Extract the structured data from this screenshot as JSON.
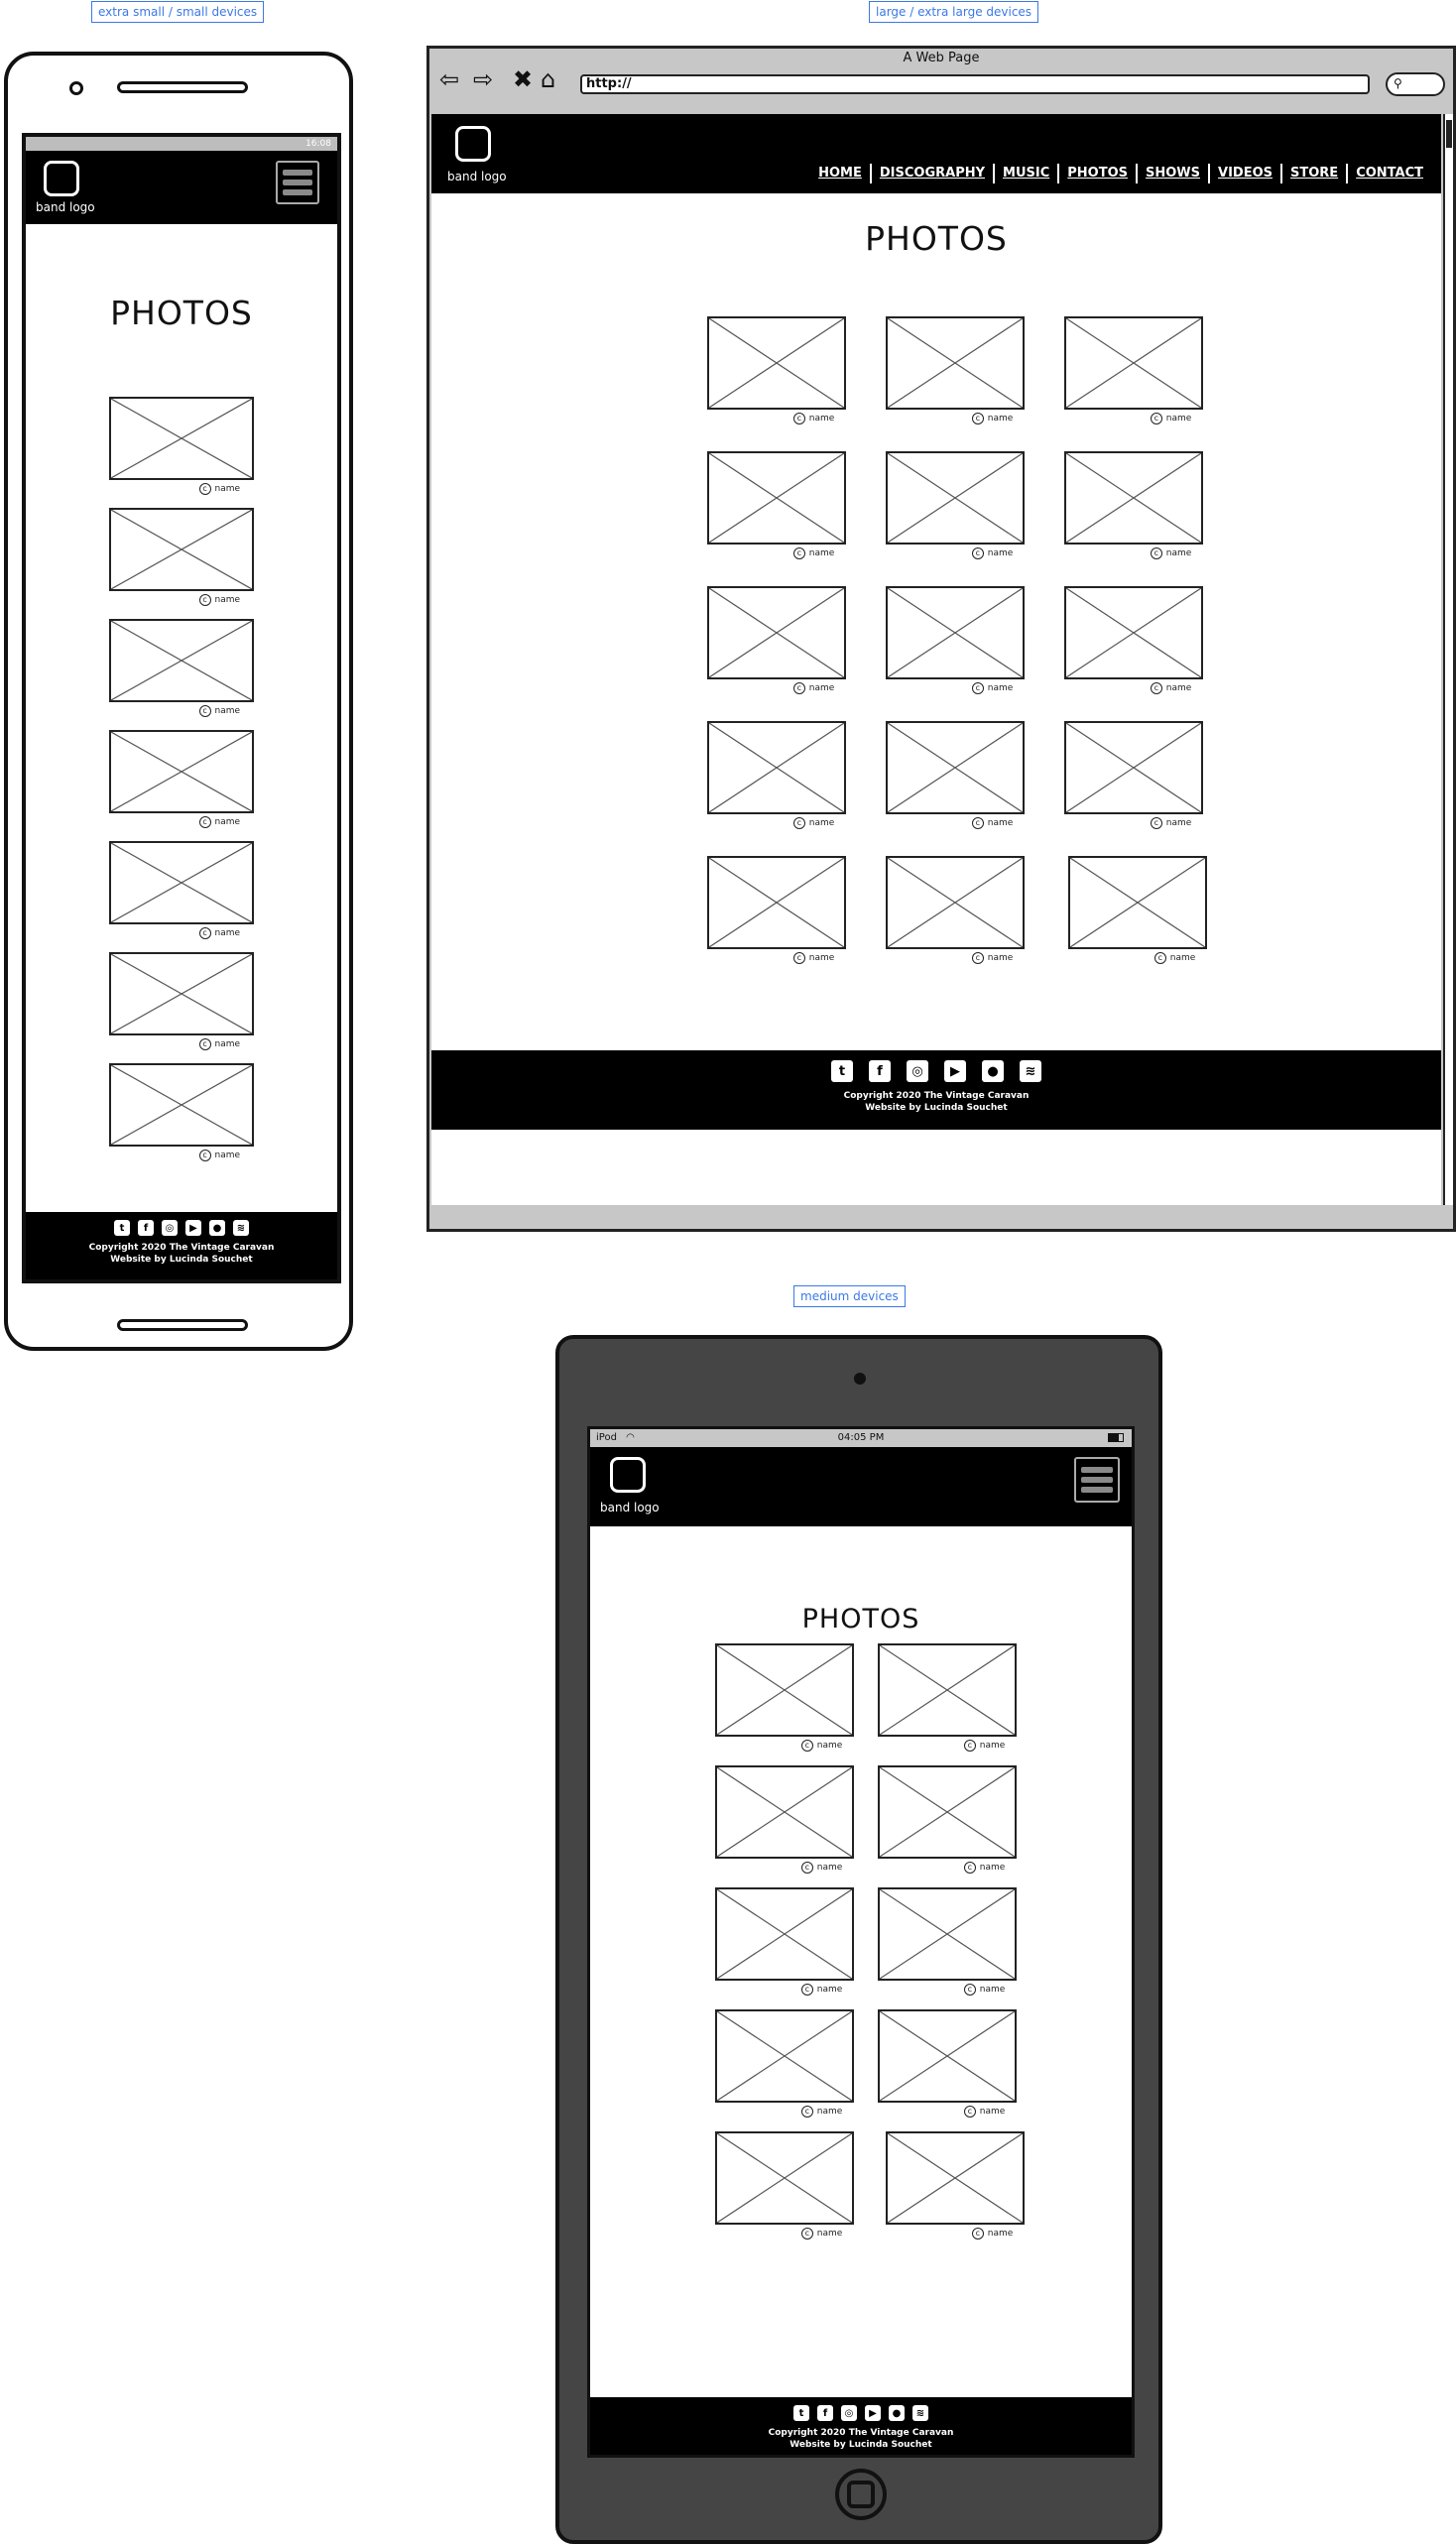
{
  "labels": {
    "small": "extra small / small devices",
    "large": "large / extra large devices",
    "medium": "medium devices"
  },
  "site": {
    "logo_text": "band logo",
    "page_title": "PHOTOS",
    "credit": "name",
    "copyright_line1": "Copyright 2020 The Vintage Caravan",
    "copyright_line2": "Website by Lucinda Souchet",
    "social_icons": [
      "twitter-icon",
      "facebook-icon",
      "instagram-icon",
      "youtube-icon",
      "apple-icon",
      "spotify-icon"
    ],
    "nav": [
      "HOME",
      "DISCOGRAPHY",
      "MUSIC",
      "PHOTOS",
      "SHOWS",
      "VIDEOS",
      "STORE",
      "CONTACT"
    ]
  },
  "browser": {
    "title": "A Web Page",
    "url": "http://"
  },
  "phone": {
    "time": "16:08"
  },
  "tablet": {
    "carrier": "iPod",
    "time": "04:05 PM"
  },
  "colors": {
    "label_blue": "#3b78e7",
    "header_bg": "#000000",
    "tablet_body": "#454545"
  }
}
